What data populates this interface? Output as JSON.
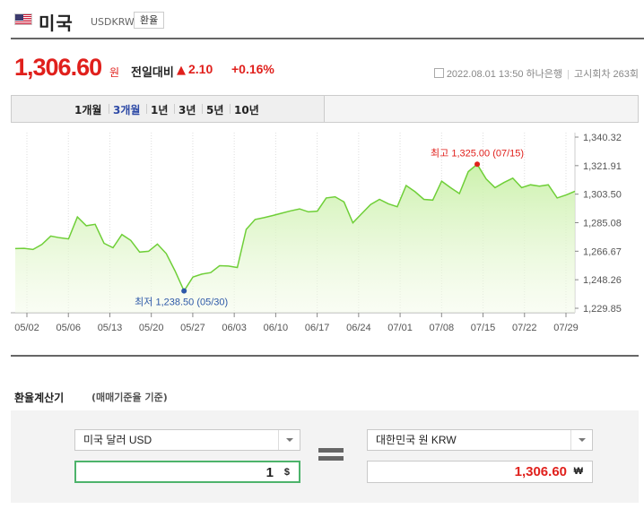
{
  "header": {
    "country": "미국",
    "code": "USDKRW",
    "exchange_button": "환율",
    "flag_colors": [
      "#3c3b6e",
      "#c8102e",
      "#ffffff"
    ]
  },
  "price": {
    "value": "1,306.60",
    "unit": "원",
    "compare_label": "전일대비",
    "arrow": "▲",
    "change": "2.10",
    "change_pct": "+0.16%",
    "datetime": "2022.08.01 13:50",
    "bank": "하나은행",
    "round": "고시회차 263회",
    "accent_color": "#e0201c"
  },
  "tabs": [
    {
      "label": "1개월",
      "active": false
    },
    {
      "label": "3개월",
      "active": true
    },
    {
      "label": "1년",
      "active": false
    },
    {
      "label": "3년",
      "active": false
    },
    {
      "label": "5년",
      "active": false
    },
    {
      "label": "10년",
      "active": false
    }
  ],
  "chart_data": {
    "type": "area",
    "ylim": [
      1223.6,
      1346.6
    ],
    "y_ticks": [
      "1,340.32",
      "1,321.91",
      "1,303.50",
      "1,285.08",
      "1,266.67",
      "1,248.26",
      "1,229.85"
    ],
    "x_ticks": [
      "05/02",
      "05/06",
      "05/13",
      "05/20",
      "05/27",
      "06/03",
      "06/10",
      "06/17",
      "06/24",
      "07/01",
      "07/08",
      "07/15",
      "07/22",
      "07/29"
    ],
    "values": [
      1267.4,
      1267.6,
      1266.8,
      1270.2,
      1276.0,
      1274.8,
      1274.0,
      1289.0,
      1283.0,
      1284.0,
      1271.0,
      1268.0,
      1277.0,
      1273.0,
      1265.0,
      1265.6,
      1270.5,
      1264.0,
      1252.0,
      1238.5,
      1248.0,
      1250.0,
      1251.0,
      1255.7,
      1255.5,
      1254.5,
      1280.5,
      1287.3,
      1288.5,
      1290.0,
      1291.6,
      1293.2,
      1294.5,
      1292.5,
      1293.0,
      1302.0,
      1302.8,
      1299.3,
      1285.0,
      1291.3,
      1297.5,
      1301.0,
      1298.0,
      1296.0,
      1310.5,
      1306.3,
      1301.0,
      1300.5,
      1313.5,
      1309.0,
      1305.0,
      1320.0,
      1325.0,
      1315.0,
      1309.0,
      1312.5,
      1315.5,
      1309.0,
      1311.0,
      1310.0,
      1311.0,
      1302.0,
      1304.0,
      1306.6
    ],
    "high": {
      "label": "최고 1,325.00 (07/15)",
      "value": 1325.0,
      "index": 52
    },
    "low": {
      "label": "최저 1,238.50 (05/30)",
      "value": 1238.5,
      "index": 19
    },
    "line_color": "#6fcf38",
    "fill_color": "#c9f0a8",
    "high_color": "#e0201c",
    "low_color": "#2e59a8"
  },
  "calculator": {
    "title": "환율계산기",
    "subtitle": "(매매기준율 기준)",
    "from_currency": "미국 달러 USD",
    "to_currency": "대한민국 원 KRW",
    "from_amount": "1",
    "from_unit": "$",
    "to_amount": "1,306.60",
    "to_unit": "₩"
  }
}
